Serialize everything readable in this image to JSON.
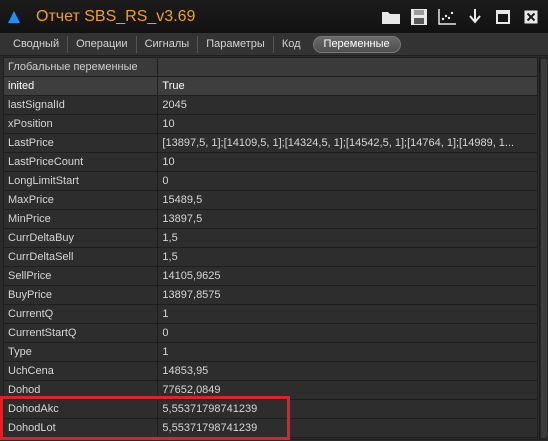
{
  "window": {
    "title": "Отчет SBS_RS_v3.69"
  },
  "toolbar": {
    "buttons": [
      {
        "name": "folder-icon",
        "label": ""
      },
      {
        "name": "save-icon",
        "label": ""
      },
      {
        "name": "chart-icon",
        "label": ""
      },
      {
        "name": "pin-icon",
        "label": ""
      },
      {
        "name": "maximize-icon",
        "label": ""
      },
      {
        "name": "close-icon",
        "label": ""
      }
    ]
  },
  "tabs": [
    {
      "label": "Сводный",
      "active": false
    },
    {
      "label": "Операции",
      "active": false
    },
    {
      "label": "Сигналы",
      "active": false
    },
    {
      "label": "Параметры",
      "active": false
    },
    {
      "label": "Код",
      "active": false
    },
    {
      "label": "Переменные",
      "active": true
    }
  ],
  "grid": {
    "group_label": "Глобальные переменные",
    "rows": [
      {
        "name": "inited",
        "value": "True"
      },
      {
        "name": "lastSignalId",
        "value": "2045"
      },
      {
        "name": "xPosition",
        "value": "10"
      },
      {
        "name": "LastPrice",
        "value": "[13897,5, 1];[14109,5, 1];[14324,5, 1];[14542,5, 1];[14764, 1];[14989, 1..."
      },
      {
        "name": "LastPriceCount",
        "value": "10"
      },
      {
        "name": "LongLimitStart",
        "value": "0"
      },
      {
        "name": "MaxPrice",
        "value": "15489,5"
      },
      {
        "name": "MinPrice",
        "value": "13897,5"
      },
      {
        "name": "CurrDeltaBuy",
        "value": "1,5"
      },
      {
        "name": "CurrDeltaSell",
        "value": "1,5"
      },
      {
        "name": "SellPrice",
        "value": "14105,9625"
      },
      {
        "name": "BuyPrice",
        "value": "13897,8575"
      },
      {
        "name": "CurrentQ",
        "value": "1"
      },
      {
        "name": "CurrentStartQ",
        "value": "0"
      },
      {
        "name": "Type",
        "value": "1"
      },
      {
        "name": "UchCena",
        "value": "14853,95"
      },
      {
        "name": "Dohod",
        "value": "77652,0849"
      },
      {
        "name": "DohodAkc",
        "value": "5,55371798741239"
      },
      {
        "name": "DohodLot",
        "value": "5,55371798741239"
      }
    ]
  },
  "colors": {
    "title": "#f2a01a",
    "highlight": "#e0212c",
    "logo": "#1e90ff"
  }
}
